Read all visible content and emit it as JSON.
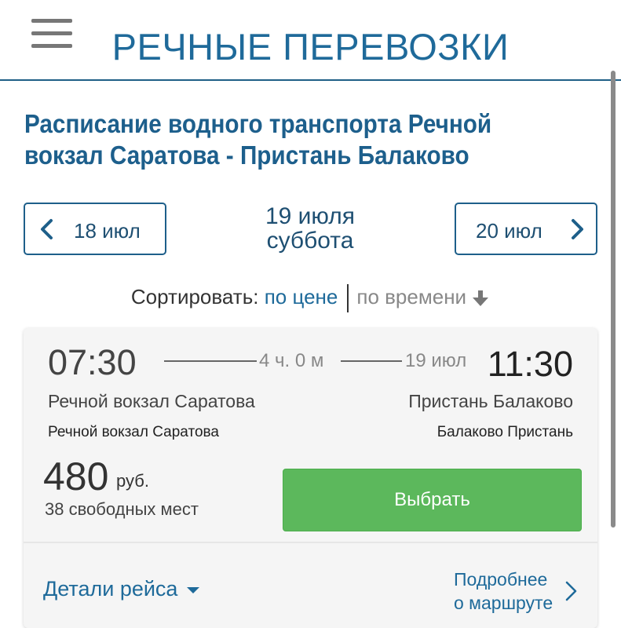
{
  "header": {
    "title": "РЕЧНЫЕ ПЕРЕВОЗКИ",
    "menu_icon": "hamburger-menu-icon"
  },
  "page": {
    "title": "Расписание водного транспорта Речной вокзал Саратова - Пристань Балаково"
  },
  "date_nav": {
    "prev_label": "18 июл",
    "next_label": "20 июл",
    "current_date": "19 июля",
    "current_weekday": "суббота"
  },
  "sort": {
    "label": "Сортировать:",
    "by_price": "по цене",
    "by_time": "по времени"
  },
  "trip": {
    "departure_time": "07:30",
    "duration": "4 ч. 0 м",
    "arrival_date": "19 июл",
    "arrival_time": "11:30",
    "departure_station": "Речной вокзал Саратова",
    "arrival_station": "Пристань Балаково",
    "departure_pier": "Речной вокзал Саратова",
    "arrival_pier": "Балаково Пристань",
    "price": "480",
    "currency": "руб.",
    "seats": "38 свободных мест",
    "choose_label": "Выбрать",
    "details_label": "Детали рейса",
    "more_line1": "Подробнее",
    "more_line2": "о маршруте"
  },
  "colors": {
    "brand_blue": "#1f6a9a",
    "accent_green": "#5cb85c",
    "card_bg": "#f5f5f5"
  }
}
